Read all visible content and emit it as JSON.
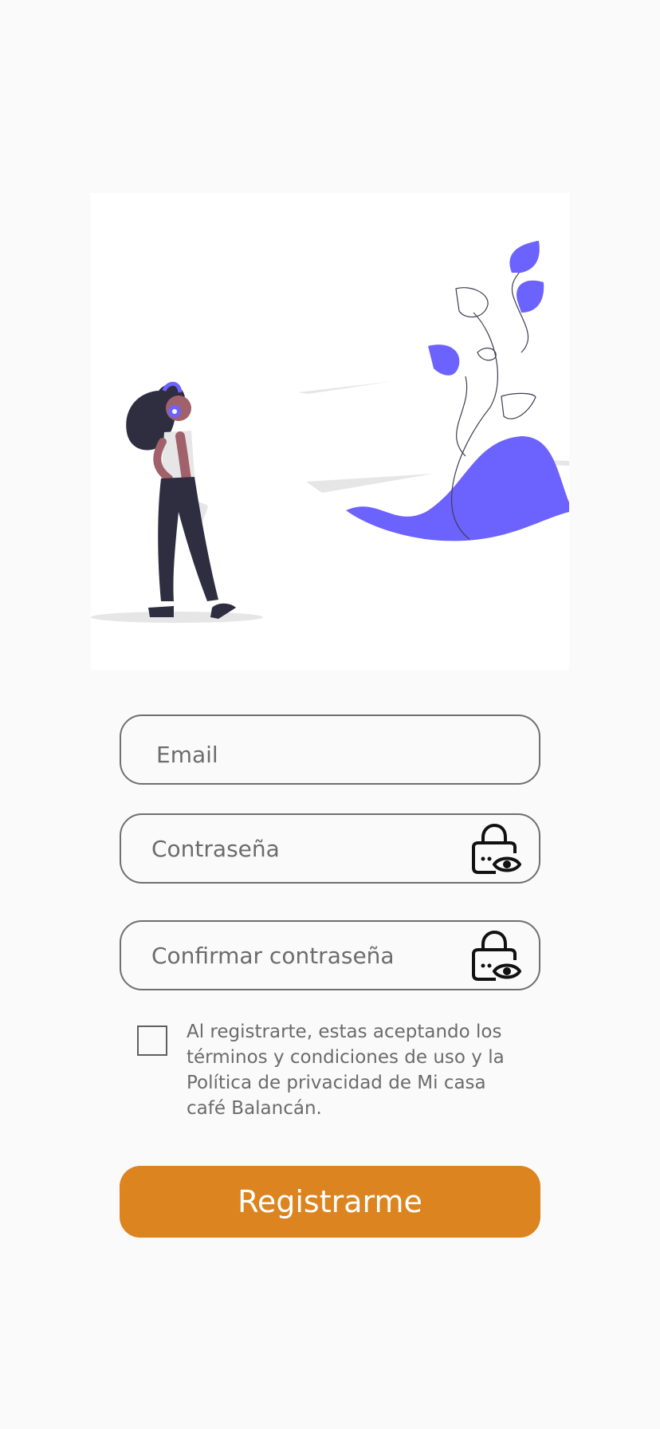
{
  "form": {
    "email_placeholder": "Email",
    "password_placeholder": "Contraseña",
    "confirm_password_placeholder": "Confirmar contraseña",
    "terms_text": "Al registrarte, estas aceptando los términos y condiciones de uso y la Política de privacidad de Mi casa café Balancán.",
    "terms_checked": false,
    "register_label": "Registrarme"
  },
  "icons": {
    "password_toggle": "lock-eye-icon",
    "confirm_password_toggle": "lock-eye-icon"
  },
  "colors": {
    "background": "#fafafa",
    "accent": "#dc841f",
    "illustration_accent": "#6c63ff",
    "field_border": "#6f6f6f",
    "text_muted": "#6c6c6c"
  }
}
